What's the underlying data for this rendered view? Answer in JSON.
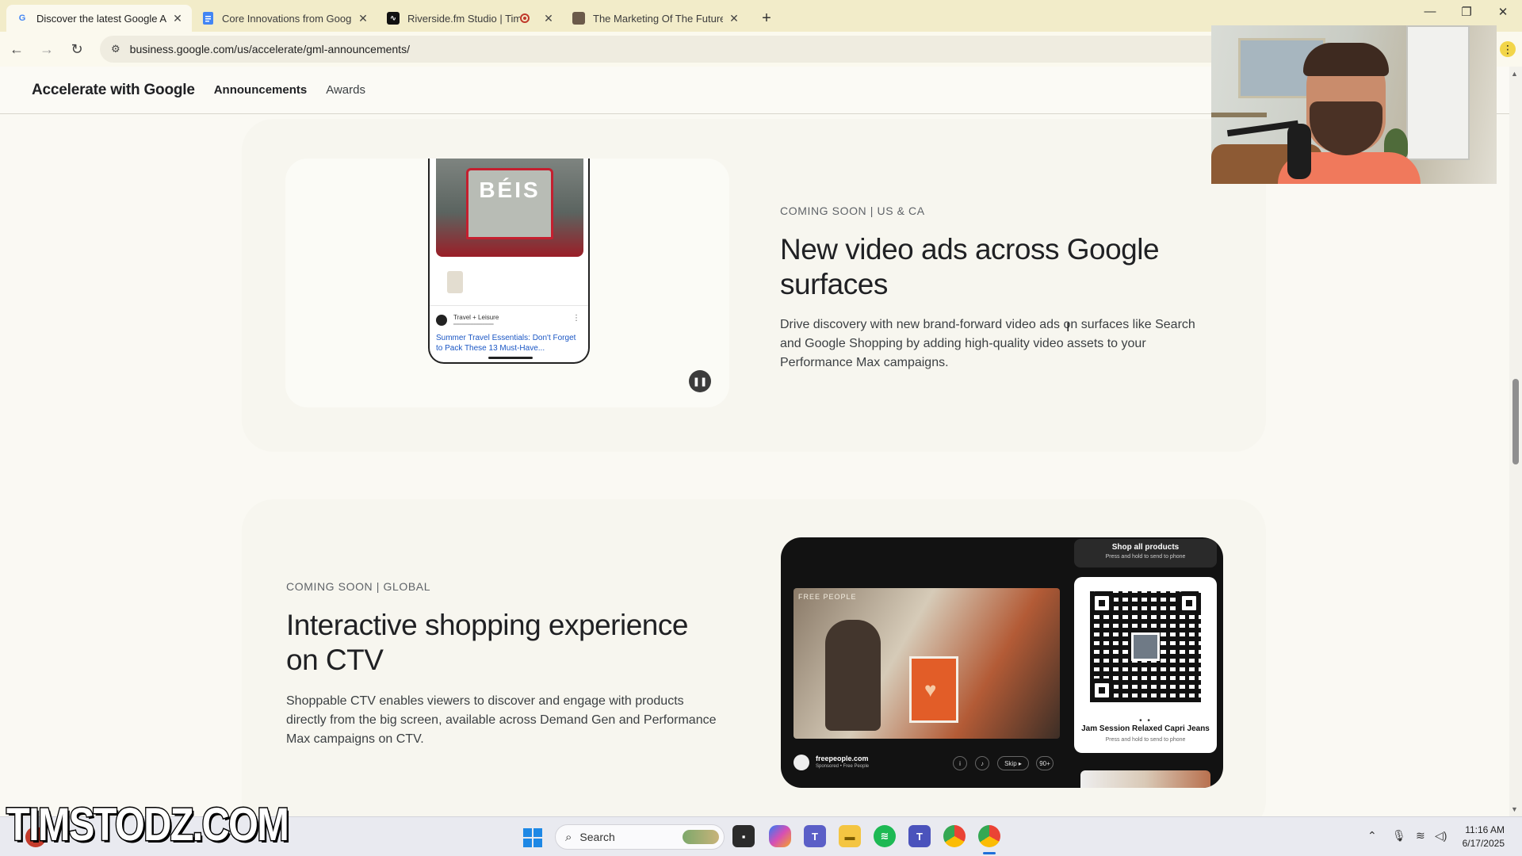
{
  "browser": {
    "tabs": [
      {
        "title": "Discover the latest Google Ads",
        "favicon": "G",
        "active": true
      },
      {
        "title": "Core Innovations from Google",
        "favicon": "doc-icon",
        "active": false
      },
      {
        "title": "Riverside.fm Studio | Tim's",
        "favicon": "riverside-icon",
        "active": false,
        "recording": true
      },
      {
        "title": "The Marketing Of The Future -",
        "favicon": "image-icon",
        "active": false
      }
    ],
    "url": "business.google.com/us/accelerate/gml-announcements/"
  },
  "site": {
    "brand": "Accelerate with Google",
    "nav": [
      "Announcements",
      "Awards"
    ]
  },
  "cards": [
    {
      "eyebrow": "COMING SOON | US & CA",
      "headline_line1": "New video ads across Google",
      "headline_line2": "surfaces",
      "body_line1": "Drive discovery with new brand-forward video ads on surfaces like Search",
      "body_line2": "and Google Shopping by adding high-quality video assets to your",
      "body_line3": "Performance Max campaigns.",
      "phone": {
        "bag_text": "BÉIS",
        "source": "Travel + Leisure",
        "link_text": "Summer Travel Essentials: Don't Forget to Pack These 13 Must-Have..."
      }
    },
    {
      "eyebrow": "COMING SOON | GLOBAL",
      "headline_line1": "Interactive shopping experience",
      "headline_line2": "on CTV",
      "body_line1": "Shoppable CTV enables viewers to discover and engage with products",
      "body_line2": "directly from the big screen, available across Demand Gen and Performance",
      "body_line3": "Max campaigns on CTV.",
      "ctv": {
        "shop_all": "Shop all products",
        "shop_hint": "Press and hold to send to phone",
        "video_brand": "FREE PEOPLE",
        "product": "Jam Session Relaxed Capri Jeans",
        "product_hint": "Press and hold to send to phone",
        "advertiser": "freepeople.com",
        "advertiser_sub": "Sponsored • Free People",
        "skip": "Skip",
        "counter": "90+"
      }
    }
  ],
  "watermark": "TIMSTODZ.COM",
  "taskbar": {
    "search_placeholder": "Search",
    "time": "11:16 AM",
    "date": "6/17/2025"
  }
}
